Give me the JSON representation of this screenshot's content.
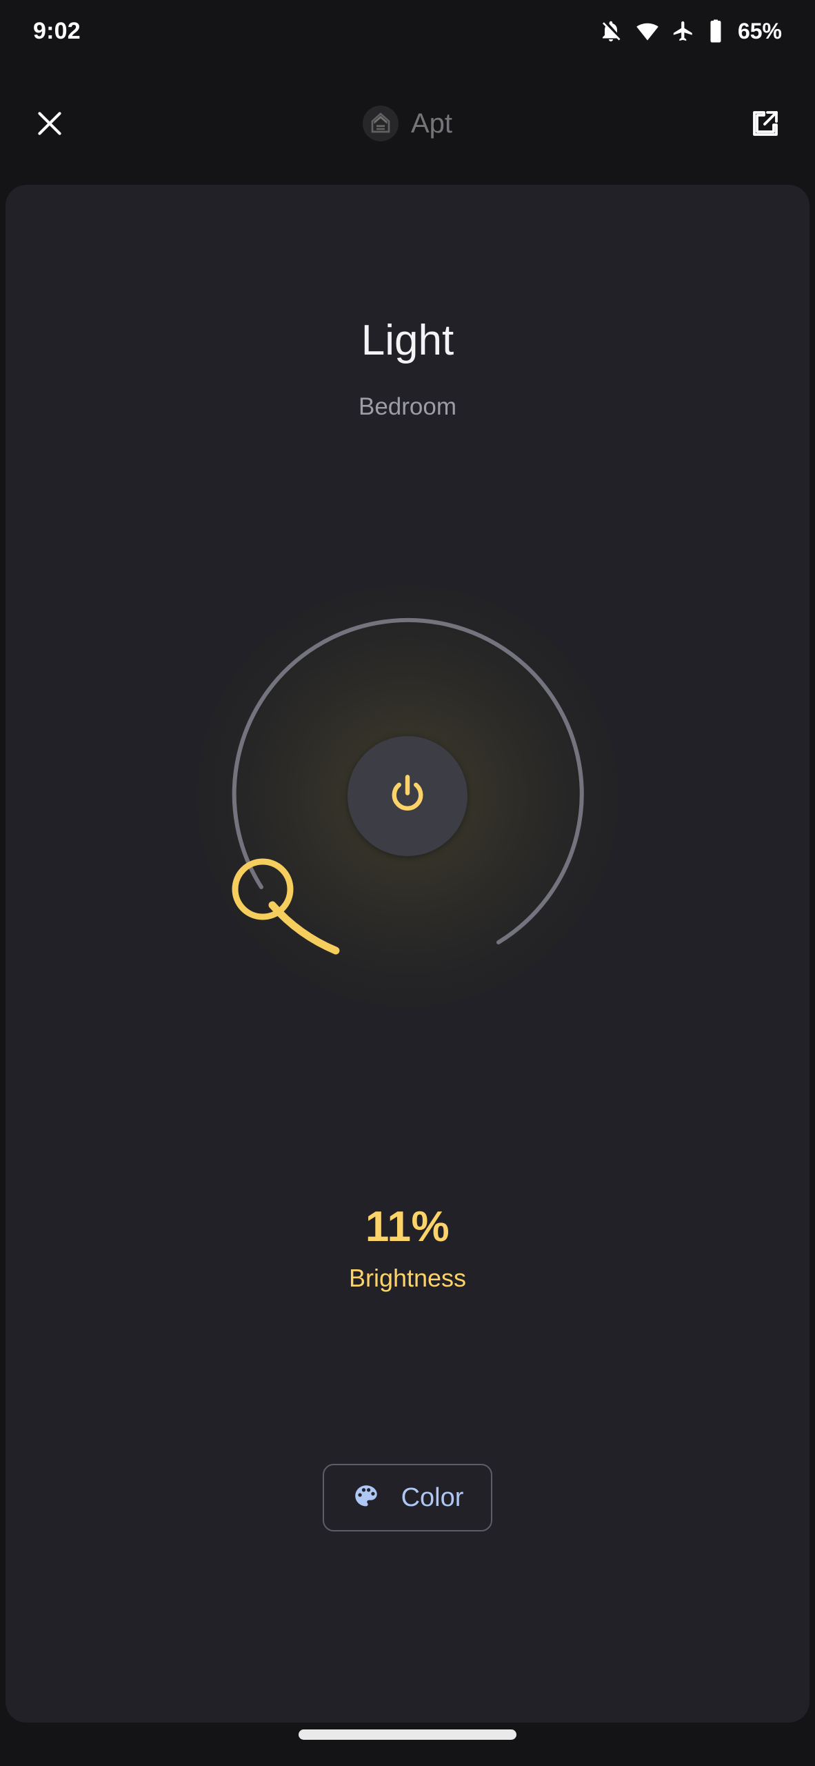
{
  "status_bar": {
    "time": "9:02",
    "battery_percent": "65%",
    "icons": [
      "notifications-off-icon",
      "wifi-icon",
      "airplane-mode-icon",
      "battery-icon"
    ]
  },
  "app_bar": {
    "close_label": "close-icon",
    "app_name": "Apt",
    "logo_name": "google-home-logo",
    "open_external_label": "open-in-new-icon"
  },
  "device": {
    "title": "Light",
    "room": "Bedroom"
  },
  "dial": {
    "power_state": "on",
    "power_icon": "power-icon",
    "brightness_value": "11%",
    "brightness_label": "Brightness",
    "brightness_number": 11
  },
  "actions": {
    "color_label": "Color",
    "color_icon": "palette-icon"
  },
  "colors": {
    "accent_yellow": "#fbd368",
    "handle_yellow": "#f6ce5d",
    "track_gray": "#74747e",
    "panel_bg": "#212127",
    "screen_bg": "#141416",
    "power_btn_bg": "#3d3d46",
    "link_blue": "#aec7f5",
    "title_white": "#f4f4f6",
    "subtitle_gray": "#9d9da6"
  }
}
